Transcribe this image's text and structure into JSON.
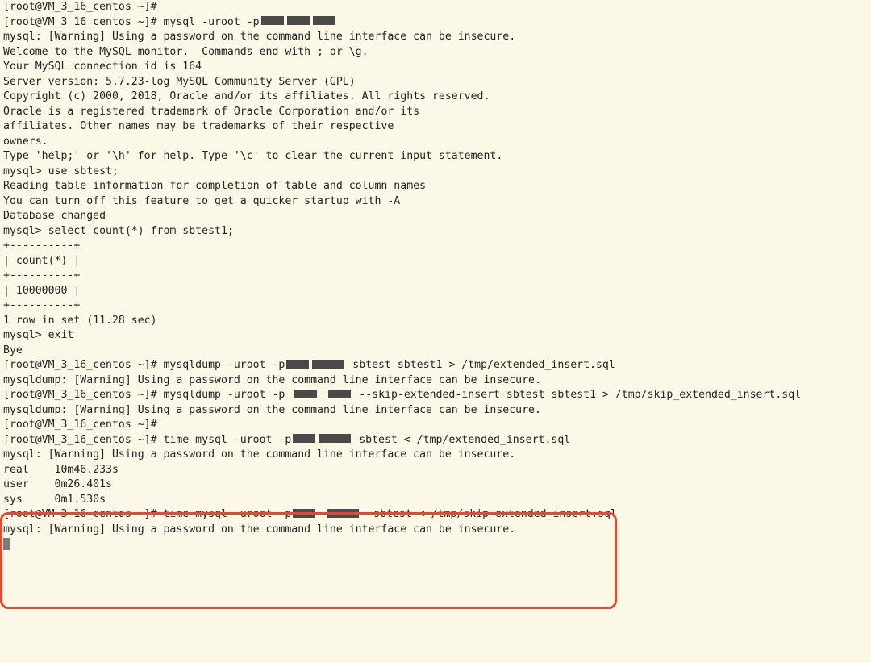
{
  "prompt": "[root@VM_3_16_centos ~]#",
  "lines": {
    "l0": "[root@VM_3_16_centos ~]#",
    "l1a": "[root@VM_3_16_centos ~]# mysql -uroot -p",
    "l2": "mysql: [Warning] Using a password on the command line interface can be insecure.",
    "l3": "Welcome to the MySQL monitor.  Commands end with ; or \\g.",
    "l4": "Your MySQL connection id is 164",
    "l5": "Server version: 5.7.23-log MySQL Community Server (GPL)",
    "l6": "",
    "l7": "Copyright (c) 2000, 2018, Oracle and/or its affiliates. All rights reserved.",
    "l8": "",
    "l9": "Oracle is a registered trademark of Oracle Corporation and/or its",
    "l10": "affiliates. Other names may be trademarks of their respective",
    "l11": "owners.",
    "l12": "",
    "l13": "Type 'help;' or '\\h' for help. Type '\\c' to clear the current input statement.",
    "l14": "",
    "l15": "mysql> use sbtest;",
    "l16": "Reading table information for completion of table and column names",
    "l17": "You can turn off this feature to get a quicker startup with -A",
    "l18": "",
    "l19": "Database changed",
    "l20": "mysql> select count(*) from sbtest1;",
    "l21": "+----------+",
    "l22": "| count(*) |",
    "l23": "+----------+",
    "l24": "| 10000000 |",
    "l25": "+----------+",
    "l26": "1 row in set (11.28 sec)",
    "l27": "",
    "l28": "mysql> exit",
    "l29": "Bye",
    "l30a": "[root@VM_3_16_centos ~]# mysqldump -uroot -p",
    "l30b": " sbtest sbtest1 > /tmp/extended_insert.sql",
    "l31": "mysqldump: [Warning] Using a password on the command line interface can be insecure.",
    "l32a": "[root@VM_3_16_centos ~]# mysqldump -uroot -p",
    "l32b": " --skip-extended-insert sbtest sbtest1 > /tmp/skip_extended_insert.sql",
    "l33": "mysqldump: [Warning] Using a password on the command line interface can be insecure.",
    "l34": "[root@VM_3_16_centos ~]#",
    "l35a": "[root@VM_3_16_centos ~]# time mysql -uroot -p",
    "l35b": " sbtest < /tmp/extended_insert.sql",
    "l36": "mysql: [Warning] Using a password on the command line interface can be insecure.",
    "l37": "",
    "l38": "real    10m46.233s",
    "l39": "user    0m26.401s",
    "l40": "sys     0m1.530s",
    "l41a": "[root@VM_3_16_centos ~]# time mysql -uroot -p",
    "l41b": "  sbtest < /tmp/skip_extended_insert.sql",
    "l42": "mysql: [Warning] Using a password on the command line interface can be insecure."
  }
}
